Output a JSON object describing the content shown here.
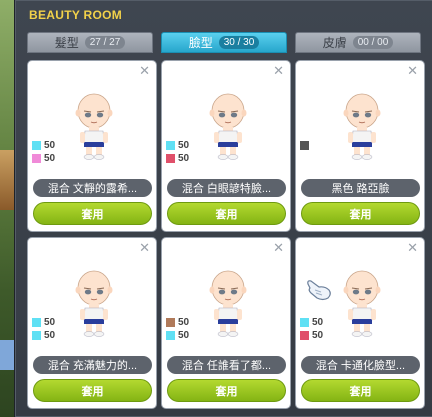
{
  "window": {
    "title": "BEAUTY ROOM"
  },
  "tabs": [
    {
      "label": "髮型",
      "count": "27 / 27",
      "active": false
    },
    {
      "label": "臉型",
      "count": "30 / 30",
      "active": true
    },
    {
      "label": "皮膚",
      "count": "00 / 00",
      "active": false
    }
  ],
  "cards": [
    {
      "name": "混合 文靜的露希...",
      "stats": [
        {
          "value": "50",
          "color": "#5fe0f4"
        },
        {
          "value": "50",
          "color": "#f08ad8"
        }
      ],
      "button": "套用"
    },
    {
      "name": "混合 白眼諺特臉...",
      "stats": [
        {
          "value": "50",
          "color": "#5fe0f4"
        },
        {
          "value": "50",
          "color": "#e0506a"
        }
      ],
      "button": "套用"
    },
    {
      "name": "黑色 路亞臉",
      "stats": [
        {
          "value": "",
          "color": "#555555"
        }
      ],
      "button": "套用"
    },
    {
      "name": "混合 充滿魅力的...",
      "stats": [
        {
          "value": "50",
          "color": "#5fe0f4"
        },
        {
          "value": "50",
          "color": "#5fe0f4"
        }
      ],
      "button": "套用"
    },
    {
      "name": "混合 任誰看了都...",
      "stats": [
        {
          "value": "50",
          "color": "#b07a5a"
        },
        {
          "value": "50",
          "color": "#5fe0f4"
        }
      ],
      "button": "套用"
    },
    {
      "name": "混合 卡通化臉型...",
      "stats": [
        {
          "value": "50",
          "color": "#5fe0f4"
        },
        {
          "value": "50",
          "color": "#e0506a"
        }
      ],
      "button": "套用"
    }
  ]
}
